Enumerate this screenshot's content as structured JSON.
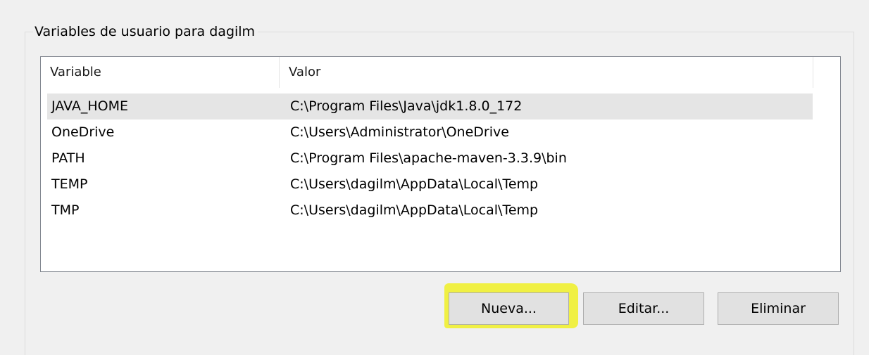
{
  "group": {
    "title": "Variables de usuario para dagilm"
  },
  "table": {
    "columns": [
      "Variable",
      "Valor"
    ],
    "rows": [
      {
        "name": "JAVA_HOME",
        "value": "C:\\Program Files\\Java\\jdk1.8.0_172",
        "selected": true
      },
      {
        "name": "OneDrive",
        "value": "C:\\Users\\Administrator\\OneDrive",
        "selected": false
      },
      {
        "name": "PATH",
        "value": "C:\\Program Files\\apache-maven-3.3.9\\bin",
        "selected": false
      },
      {
        "name": "TEMP",
        "value": "C:\\Users\\dagilm\\AppData\\Local\\Temp",
        "selected": false
      },
      {
        "name": "TMP",
        "value": "C:\\Users\\dagilm\\AppData\\Local\\Temp",
        "selected": false
      }
    ]
  },
  "buttons": {
    "new_label": "Nueva...",
    "edit_label": "Editar...",
    "delete_label": "Eliminar"
  },
  "colors": {
    "highlight": "#f0f000",
    "selected_row": "#e5e5e5",
    "background": "#f0f0f0"
  }
}
